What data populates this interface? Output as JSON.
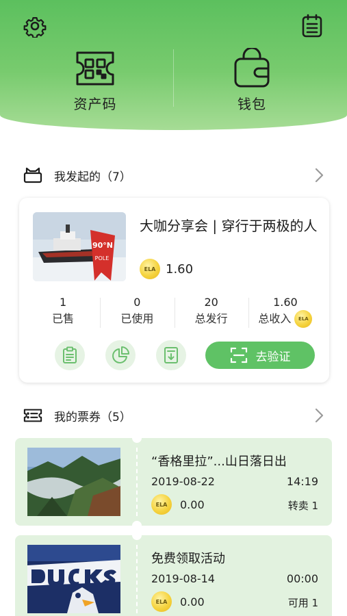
{
  "header": {
    "asset_code_label": "资产码",
    "wallet_label": "钱包",
    "settings_icon": "gear-icon",
    "record_icon": "clipboard-list-icon"
  },
  "issued_section": {
    "title": "我发起的（7）",
    "icon": "cat-box-icon"
  },
  "event_card": {
    "title": "大咖分享会 | 穿行于两极的人",
    "coin_label": "ELA",
    "price": "1.60",
    "stats": [
      {
        "value": "1",
        "label": "已售"
      },
      {
        "value": "0",
        "label": "已使用"
      },
      {
        "value": "20",
        "label": "总发行"
      },
      {
        "value": "1.60",
        "label": "总收入"
      }
    ],
    "verify_label": "去验证"
  },
  "tickets_section": {
    "title": "我的票券（5）",
    "icon": "ticket-list-icon"
  },
  "tickets": [
    {
      "title": "“香格里拉”...山日落日出",
      "date": "2019-08-22",
      "time": "14:19",
      "coin_label": "ELA",
      "price": "0.00",
      "status": "转卖 1"
    },
    {
      "title": "免费领取活动",
      "date": "2019-08-14",
      "time": "00:00",
      "coin_label": "ELA",
      "price": "0.00",
      "status": "可用 1"
    }
  ],
  "colors": {
    "brand_green": "#5fc265",
    "ticket_bg": "#e2f2df",
    "coin_gold": "#f5d33f"
  }
}
